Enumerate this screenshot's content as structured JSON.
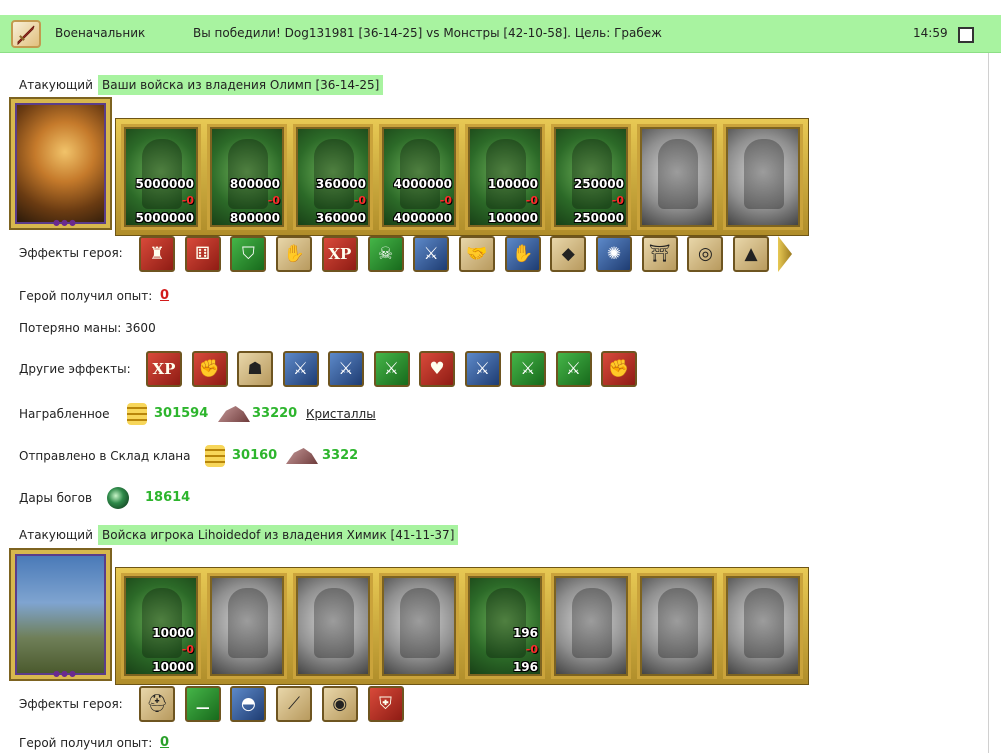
{
  "header": {
    "title": "Военачальник",
    "message": "Вы победили! Dog131981 [36-14-25] vs Монстры [42-10-58]. Цель: Грабеж",
    "time": "14:59",
    "icon": "sword-icon",
    "bg_color": "#a8f3a0"
  },
  "block1": {
    "attacker_label": "Атакующий",
    "attacker_tag": "Ваши войска из владения Олимп [36-14-25]",
    "units": [
      {
        "top": "5000000",
        "loss": "-0",
        "bottom": "5000000",
        "state": "color"
      },
      {
        "top": "800000",
        "loss": "-0",
        "bottom": "800000",
        "state": "color"
      },
      {
        "top": "360000",
        "loss": "-0",
        "bottom": "360000",
        "state": "color"
      },
      {
        "top": "4000000",
        "loss": "-0",
        "bottom": "4000000",
        "state": "color"
      },
      {
        "top": "100000",
        "loss": "-0",
        "bottom": "100000",
        "state": "color"
      },
      {
        "top": "250000",
        "loss": "-0",
        "bottom": "250000",
        "state": "color"
      },
      {
        "state": "gray"
      },
      {
        "state": "gray"
      }
    ],
    "hero_effects_label": "Эффекты героя:",
    "hero_effects_icons": [
      "tower-icon",
      "dice-icon",
      "shield-icon",
      "handshake-shield-icon",
      "xp-icon",
      "xp-monster-icon",
      "sword-icon",
      "handshake-icon",
      "crystal-hand-icon",
      "ruby-icon",
      "spider-web-icon",
      "gate-icon",
      "ring-icon",
      "tent-icon"
    ],
    "hero_effects_xp": "XP",
    "exp_label": "Герой получил опыт:",
    "exp_value": "0",
    "mana_label": "Потеряно маны: 3600",
    "other_effects_label": "Другие эффекты:",
    "other_effects_icons": [
      "xp-icon",
      "fist-sword-icon",
      "bag-icon",
      "sword-icon",
      "sword-icon",
      "sword-green-icon",
      "heart-sword-icon",
      "sword-icon",
      "sword-green-icon",
      "sword-green-icon",
      "fist-sword-icon"
    ],
    "other_effects_xp": "XP",
    "loot_label": "Награбленное",
    "loot_gold": "301594",
    "loot_crystal": "33220",
    "loot_link": "Кристаллы",
    "clan_label": "Отправлено в Склад клана",
    "clan_gold": "30160",
    "clan_crystal": "3322",
    "gods_label": "Дары богов",
    "gods_value": "18614"
  },
  "block2": {
    "attacker_label": "Атакующий",
    "attacker_tag": "Войска игрока Lihoidedof из владения Химик [41-11-37]",
    "units": [
      {
        "top": "10000",
        "loss": "-0",
        "bottom": "10000",
        "state": "color"
      },
      {
        "state": "gray"
      },
      {
        "state": "gray"
      },
      {
        "state": "gray"
      },
      {
        "top": "196",
        "loss": "-0",
        "bottom": "196",
        "state": "color"
      },
      {
        "state": "gray"
      },
      {
        "state": "gray"
      },
      {
        "state": "gray"
      }
    ],
    "hero_effects_label": "Эффекты героя:",
    "hero_effects_icons": [
      "helmet-icon",
      "boots-icon",
      "cauldron-icon",
      "spear-icon",
      "round-shield-icon",
      "armor-icon"
    ],
    "exp_label": "Герой получил опыт:",
    "exp_value": "0"
  }
}
